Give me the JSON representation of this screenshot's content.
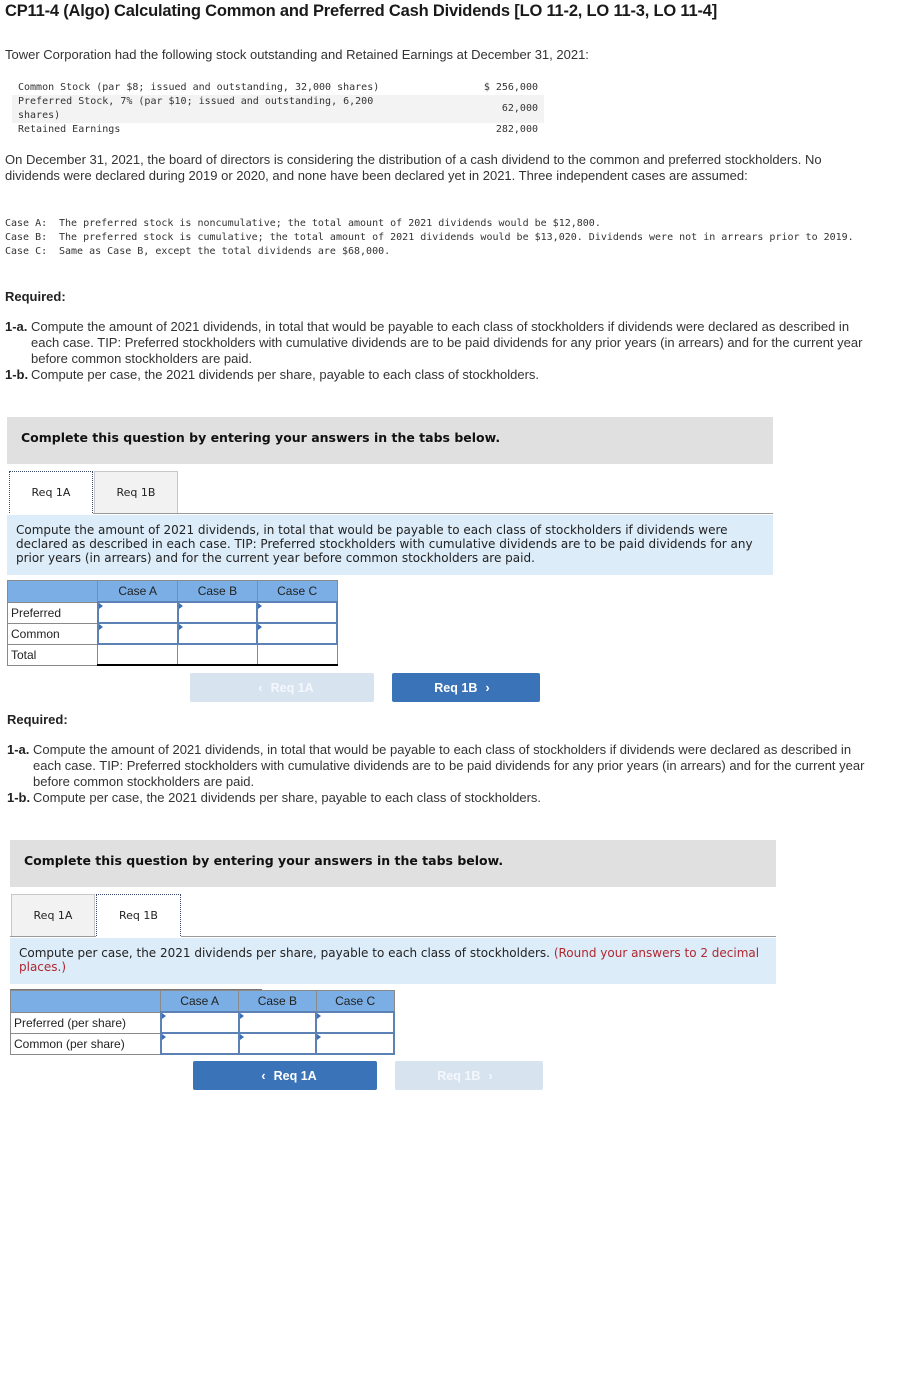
{
  "title": "CP11-4 (Algo) Calculating Common and Preferred Cash Dividends [LO 11-2, LO 11-3, LO 11-4]",
  "intro": "Tower Corporation had the following stock outstanding and Retained Earnings at December 31, 2021:",
  "stock_table": [
    {
      "label": "Common Stock (par $8; issued and outstanding, 32,000 shares)",
      "amount": "$ 256,000"
    },
    {
      "label": "Preferred Stock, 7% (par $10; issued and outstanding, 6,200 shares)",
      "amount": "62,000"
    },
    {
      "label": "Retained Earnings",
      "amount": "282,000"
    }
  ],
  "paragraph": "On December 31, 2021, the board of directors is considering the distribution of a cash dividend to the common and preferred stockholders. No dividends were declared during 2019 or 2020, and none have been declared yet in 2021. Three independent cases are assumed:",
  "cases": [
    {
      "label": "Case A:",
      "text": "The preferred stock is noncumulative; the total amount of 2021 dividends would be $12,800."
    },
    {
      "label": "Case B:",
      "text": "The preferred stock is cumulative; the total amount of 2021 dividends would be $13,020. Dividends were not in arrears prior to 2019."
    },
    {
      "label": "Case C:",
      "text": "Same as Case B, except the total dividends are $68,000."
    }
  ],
  "required": {
    "heading": "Required:",
    "items": [
      {
        "num": "1-a.",
        "text": "Compute the amount of 2021 dividends, in total that would be payable to each class of stockholders if dividends were declared as described in each case. TIP: Preferred stockholders with cumulative dividends are to be paid dividends for any prior years (in arrears) and for the current year before common stockholders are paid."
      },
      {
        "num": "1-b.",
        "text": "Compute per case, the 2021 dividends per share, payable to each class of stockholders."
      }
    ]
  },
  "banner": "Complete this question by entering your answers in the tabs below.",
  "tabs": [
    "Req 1A",
    "Req 1B"
  ],
  "panel1": {
    "instruction": "Compute the amount of 2021 dividends, in total that would be payable to each class of stockholders if dividends were declared as described in each case. TIP: Preferred stockholders with cumulative dividends are to be paid dividends for any prior years (in arrears) and for the current year before common stockholders are paid.",
    "columns": [
      "Case A",
      "Case B",
      "Case C"
    ],
    "rows": [
      {
        "label": "Preferred",
        "values": [
          "",
          "",
          ""
        ]
      },
      {
        "label": "Common",
        "values": [
          "",
          "",
          ""
        ]
      },
      {
        "label": "Total",
        "values": [
          "",
          "",
          ""
        ]
      }
    ],
    "prev_button": "Req 1A",
    "next_button": "Req 1B"
  },
  "panel2": {
    "instruction": "Compute per case, the 2021 dividends per share, payable to each class of stockholders.",
    "instruction_note": "(Round your answers to 2 decimal places.)",
    "columns": [
      "Case A",
      "Case B",
      "Case C"
    ],
    "rows": [
      {
        "label": "Preferred (per share)",
        "values": [
          "",
          "",
          ""
        ]
      },
      {
        "label": "Common (per share)",
        "values": [
          "",
          "",
          ""
        ]
      }
    ],
    "prev_button": "Req 1A",
    "next_button": "Req 1B"
  }
}
